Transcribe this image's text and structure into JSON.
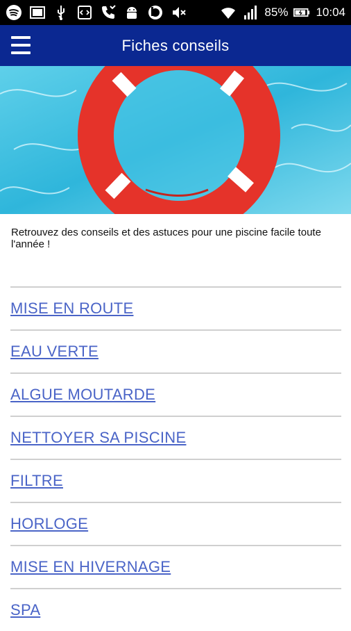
{
  "status_bar": {
    "icons": [
      "spotify-icon",
      "image-icon",
      "usb-icon",
      "code-icon",
      "phone-call-icon",
      "android-icon",
      "beats-icon",
      "mute-icon",
      "wifi-icon",
      "signal-icon",
      "battery-charging-icon"
    ],
    "battery": "85%",
    "time": "10:04"
  },
  "app_bar": {
    "title": "Fiches conseils",
    "menu_icon": "hamburger-menu-icon",
    "background": "#0b2891"
  },
  "intro_text": "Retrouvez des conseils et des astuces pour une piscine facile toute l'année !",
  "list": {
    "items": [
      {
        "label": "MISE EN ROUTE"
      },
      {
        "label": "EAU VERTE"
      },
      {
        "label": "ALGUE MOUTARDE"
      },
      {
        "label": "NETTOYER SA PISCINE"
      },
      {
        "label": "FILTRE"
      },
      {
        "label": "HORLOGE"
      },
      {
        "label": "MISE EN HIVERNAGE"
      },
      {
        "label": "SPA"
      }
    ],
    "link_color": "#4a64c7"
  }
}
